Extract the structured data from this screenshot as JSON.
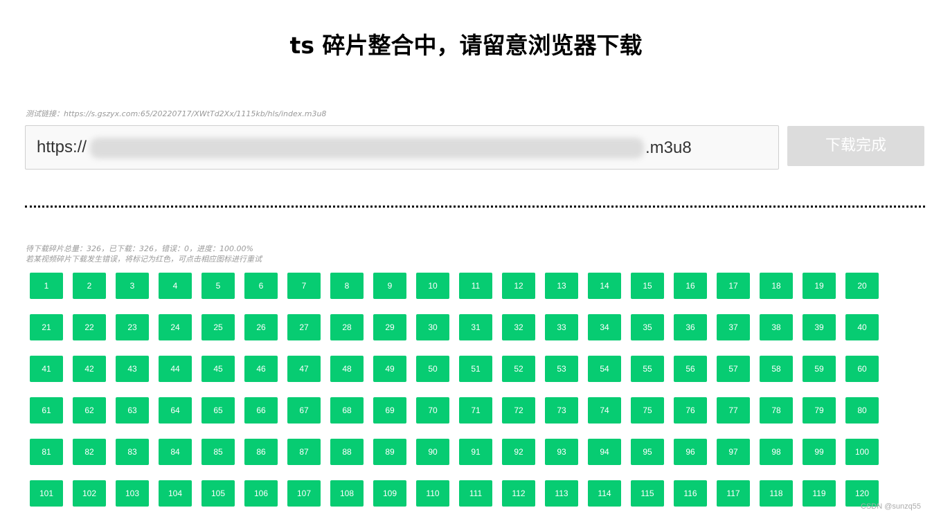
{
  "header": {
    "title": "ts 碎片整合中，请留意浏览器下载"
  },
  "test_link": {
    "text": "测试链接：https://s.gszyx.com:65/20220717/XWtTd2Xx/1115kb/hls/index.m3u8"
  },
  "url_input": {
    "value": "https://",
    "value_suffix": ".m3u8"
  },
  "download_button": {
    "label": "下载完成"
  },
  "stats": {
    "line1": "待下载碎片总量：326，已下载：326，错误：0，进度：100.00%",
    "line2": "若某视频碎片下载发生错误，将标记为红色，可点击相应图标进行重试"
  },
  "segments": {
    "labels": [
      "1",
      "2",
      "3",
      "4",
      "5",
      "6",
      "7",
      "8",
      "9",
      "10",
      "11",
      "12",
      "13",
      "14",
      "15",
      "16",
      "17",
      "18",
      "19",
      "20",
      "21",
      "22",
      "23",
      "24",
      "25",
      "26",
      "27",
      "28",
      "29",
      "30",
      "31",
      "32",
      "33",
      "34",
      "35",
      "36",
      "37",
      "38",
      "39",
      "40",
      "41",
      "42",
      "43",
      "44",
      "45",
      "46",
      "47",
      "48",
      "49",
      "50",
      "51",
      "52",
      "53",
      "54",
      "55",
      "56",
      "57",
      "58",
      "59",
      "60",
      "61",
      "62",
      "63",
      "64",
      "65",
      "66",
      "67",
      "68",
      "69",
      "70",
      "71",
      "72",
      "73",
      "74",
      "75",
      "76",
      "77",
      "78",
      "79",
      "80",
      "81",
      "82",
      "83",
      "84",
      "85",
      "86",
      "87",
      "88",
      "89",
      "90",
      "91",
      "92",
      "93",
      "94",
      "95",
      "96",
      "97",
      "98",
      "99",
      "100",
      "101",
      "102",
      "103",
      "104",
      "105",
      "106",
      "107",
      "108",
      "109",
      "110",
      "111",
      "112",
      "113",
      "114",
      "115",
      "116",
      "117",
      "118",
      "119",
      "120"
    ],
    "success_color": "#07cc72",
    "error_color": "#e74c3c"
  },
  "watermark": {
    "text": "CSDN @sunzq55"
  }
}
